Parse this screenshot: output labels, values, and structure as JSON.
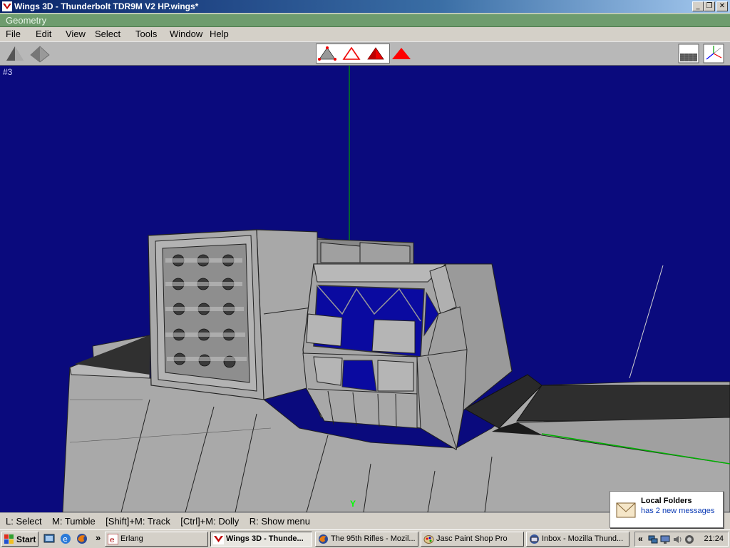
{
  "window": {
    "title": "Wings 3D - Thunderbolt TDR9M V2 HP.wings*",
    "min_glyph": "_",
    "restore_glyph": "❐",
    "close_glyph": "✕"
  },
  "geometry_bar": {
    "label": "Geometry"
  },
  "menu": {
    "items": [
      {
        "label": "File"
      },
      {
        "label": "Edit"
      },
      {
        "label": "View"
      },
      {
        "label": "Select"
      },
      {
        "label": "Tools"
      },
      {
        "label": "Window"
      },
      {
        "label": "Help"
      }
    ]
  },
  "toolbar": {
    "left_icons": [
      "smooth-shading-icon",
      "flat-shading-icon"
    ],
    "select_modes": [
      "vertex-mode-icon",
      "edge-mode-icon",
      "face-mode-icon",
      "body-mode-icon"
    ],
    "right_icons": [
      "ground-grid-icon",
      "axes-icon"
    ]
  },
  "viewport": {
    "label": "#3",
    "axis_label": "Y",
    "background": "#0a0a7d"
  },
  "status": {
    "text": "L: Select    M: Tumble    [Shift]+M: Track    [Ctrl]+M: Dolly    R: Show menu"
  },
  "notification": {
    "title": "Local Folders",
    "message": "has 2 new messages"
  },
  "taskbar": {
    "start_label": "Start",
    "overflow_glyph": "»",
    "tasks": [
      {
        "label": "Erlang",
        "icon": "erlang-icon",
        "active": false
      },
      {
        "label": "Wings 3D - Thunde...",
        "icon": "wings3d-icon",
        "active": true
      },
      {
        "label": "The 95th Rifles - Mozil...",
        "icon": "firefox-icon",
        "active": false
      },
      {
        "label": "Jasc Paint Shop Pro",
        "icon": "paintshop-icon",
        "active": false
      },
      {
        "label": "Inbox - Mozilla Thund...",
        "icon": "thunderbird-icon",
        "active": false
      }
    ],
    "tray_chevron": "«",
    "clock": "21:24"
  }
}
